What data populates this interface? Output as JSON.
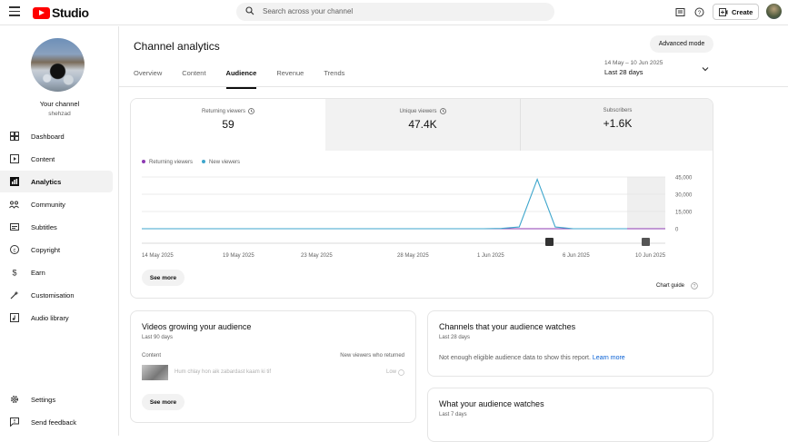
{
  "app": {
    "logo_text": "Studio"
  },
  "search": {
    "placeholder": "Search across your channel"
  },
  "topbar": {
    "create_label": "Create"
  },
  "channel": {
    "name": "Your channel",
    "handle": "shehzad"
  },
  "sidebar": {
    "items": [
      {
        "label": "Dashboard",
        "icon": "dashboard-icon"
      },
      {
        "label": "Content",
        "icon": "content-icon"
      },
      {
        "label": "Analytics",
        "icon": "analytics-icon",
        "active": true
      },
      {
        "label": "Community",
        "icon": "community-icon"
      },
      {
        "label": "Subtitles",
        "icon": "subtitles-icon"
      },
      {
        "label": "Copyright",
        "icon": "copyright-icon"
      },
      {
        "label": "Earn",
        "icon": "earn-icon"
      },
      {
        "label": "Customisation",
        "icon": "customisation-icon"
      },
      {
        "label": "Audio library",
        "icon": "audio-library-icon"
      }
    ],
    "bottom": [
      {
        "label": "Settings",
        "icon": "settings-icon"
      },
      {
        "label": "Send feedback",
        "icon": "feedback-icon"
      }
    ]
  },
  "page": {
    "title": "Channel analytics",
    "advanced_mode": "Advanced mode"
  },
  "tabs": [
    {
      "label": "Overview"
    },
    {
      "label": "Content"
    },
    {
      "label": "Audience",
      "active": true
    },
    {
      "label": "Revenue"
    },
    {
      "label": "Trends"
    }
  ],
  "date_range": {
    "range": "14 May – 10 Jun 2025",
    "label": "Last 28 days"
  },
  "metrics": [
    {
      "label": "Returning viewers",
      "value": "59"
    },
    {
      "label": "Unique viewers",
      "value": "47.4K"
    },
    {
      "label": "Subscribers",
      "value": "+1.6K"
    }
  ],
  "chart_data": {
    "type": "line",
    "x_tick_labels": [
      "14 May 2025",
      "19 May 2025",
      "23 May 2025",
      "28 May 2025",
      "1 Jun 2025",
      "6 Jun 2025",
      "10 Jun 2025"
    ],
    "y_tick_labels": [
      "45,000",
      "30,000",
      "15,000",
      "0"
    ],
    "ylim": [
      0,
      45000
    ],
    "grid": true,
    "legend_placement": "top-left",
    "series": [
      {
        "name": "Returning viewers",
        "color": "#8e3bb3",
        "values": [
          0,
          0,
          0,
          0,
          0,
          0,
          0,
          0,
          0,
          0,
          0,
          0,
          0,
          0,
          0,
          0,
          0,
          0,
          0,
          0,
          0,
          0,
          0,
          0,
          0,
          0,
          0,
          0
        ]
      },
      {
        "name": "New viewers",
        "color": "#3ea6cc",
        "values": [
          0,
          0,
          0,
          0,
          0,
          0,
          0,
          0,
          0,
          0,
          0,
          0,
          0,
          0,
          0,
          0,
          0,
          0,
          0,
          0,
          200,
          1500,
          43000,
          1500,
          0,
          0,
          0,
          0
        ]
      }
    ]
  },
  "chart_footer": {
    "see_more": "See more",
    "chart_guide": "Chart guide"
  },
  "videos_card": {
    "title": "Videos growing your audience",
    "subtitle": "Last 90 days",
    "col_content": "Content",
    "col_metric": "New viewers who returned",
    "video_title": "Hum chlay hon aik zabardast kaam ki tif",
    "video_value": "Low",
    "see_more": "See more"
  },
  "channels_card": {
    "title": "Channels that your audience watches",
    "subtitle": "Last 28 days",
    "message": "Not enough eligible audience data to show this report.",
    "link": "Learn more"
  },
  "watches_card": {
    "title": "What your audience watches",
    "subtitle": "Last 7 days"
  }
}
